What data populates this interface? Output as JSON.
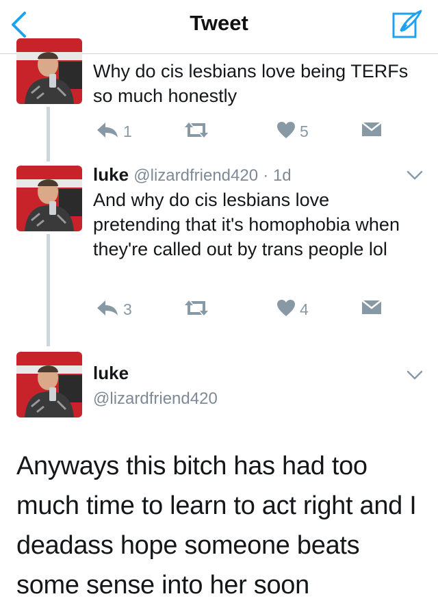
{
  "nav": {
    "title": "Tweet"
  },
  "tweets": [
    {
      "text": "Why do cis lesbians love being TERFs so much honestly",
      "replies": "1",
      "likes": "5"
    },
    {
      "name": "luke",
      "handle": "@lizardfriend420",
      "time": "· 1d",
      "text": "And why do cis lesbians love pretending that it's homophobia when they're called out by trans people lol",
      "replies": "3",
      "likes": "4"
    }
  ],
  "focused": {
    "name": "luke",
    "handle": "@lizardfriend420",
    "text": "Anyways this bitch has had too much time to learn to act right and I deadass hope someone beats some sense into her soon"
  },
  "colors": {
    "accent": "#1da1f2",
    "muted": "#8899a6",
    "thread": "#ccd6dd"
  }
}
